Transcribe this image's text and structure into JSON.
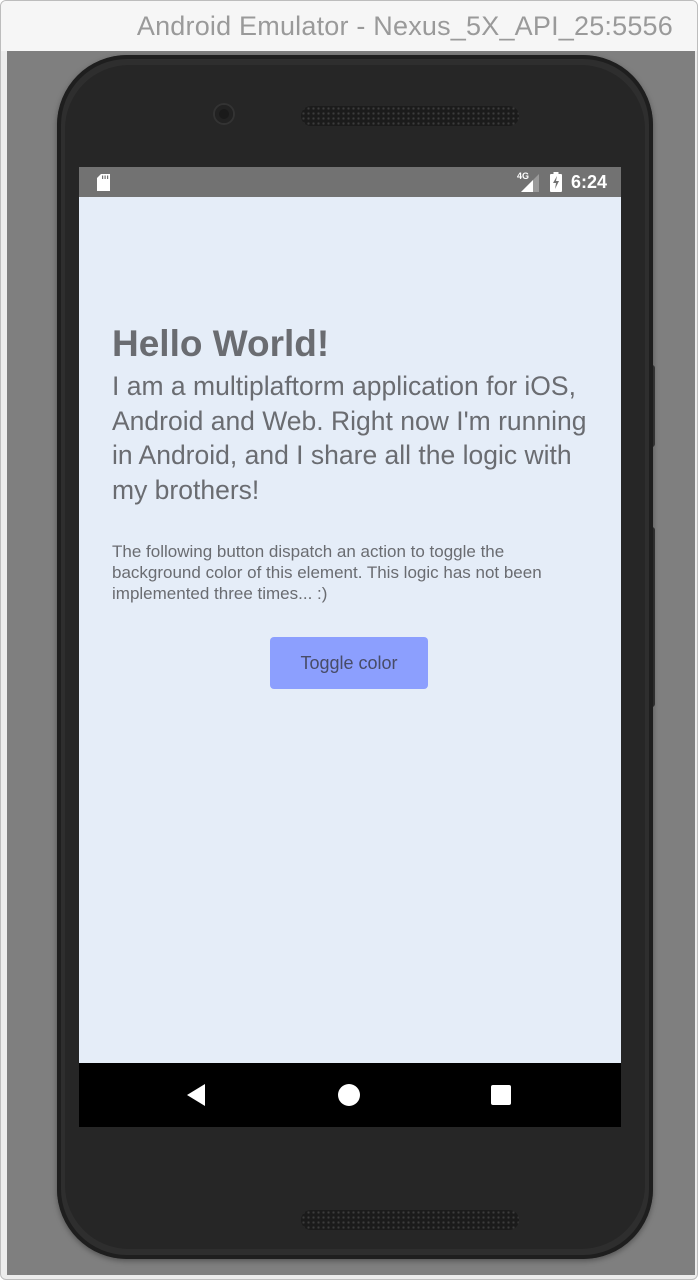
{
  "window": {
    "title": "Android Emulator - Nexus_5X_API_25:5556"
  },
  "status_bar": {
    "network_type": "4G",
    "time": "6:24",
    "icons": [
      "sdcard-icon",
      "network-signal-icon",
      "battery-charging-icon"
    ]
  },
  "app": {
    "title": "Hello World!",
    "intro": "I am a multiplaftorm application for iOS, Android and Web. Right now I'm running in Android, and I share all the logic with my brothers!",
    "description": "The following button dispatch an action to toggle the background color of this element. This logic has not been implemented three times... :)",
    "toggle_button_label": "Toggle color"
  },
  "nav_bar": {
    "icons": [
      "back-icon",
      "home-icon",
      "recents-icon"
    ]
  },
  "colors": {
    "screen_background": "#e5edf8",
    "button_background": "#8c9ffe",
    "text": "#6a6c71"
  }
}
